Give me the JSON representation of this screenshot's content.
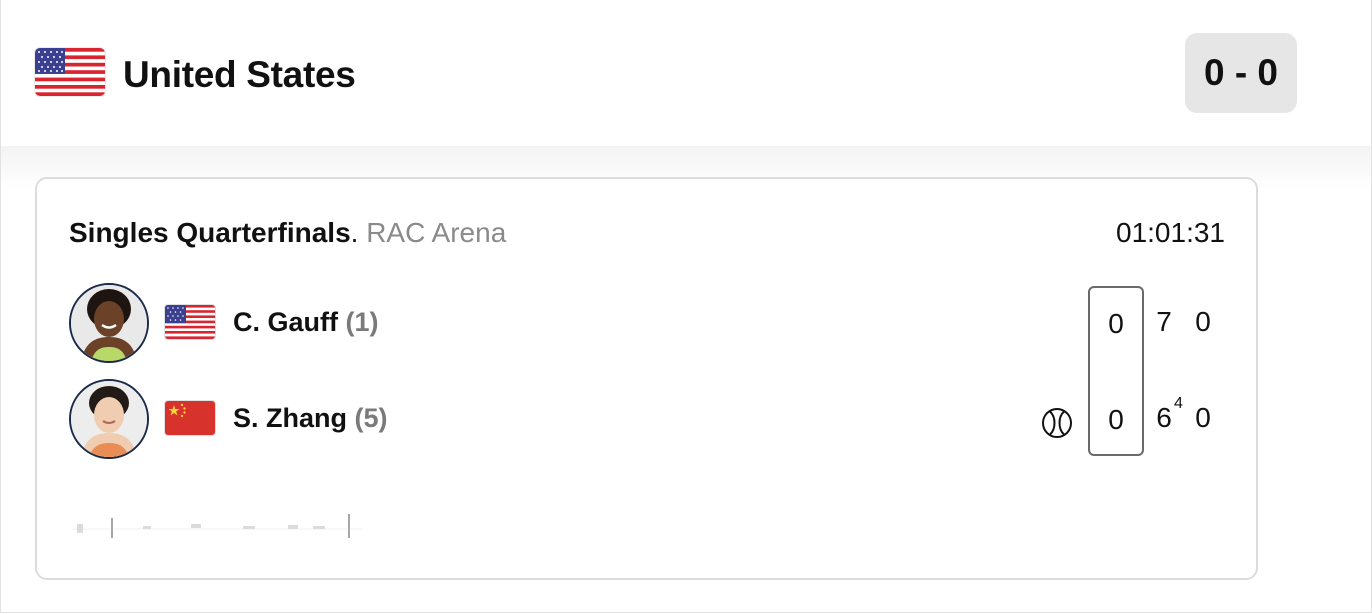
{
  "team": {
    "name": "United States",
    "score": "0 - 0",
    "flag_icon": "us-flag-icon"
  },
  "match": {
    "round": "Singles Quarterfinals",
    "separator": ".",
    "venue": "RAC Arena",
    "clock": "01:01:31",
    "serving_player_index": 1,
    "players": [
      {
        "name": "C. Gauff",
        "seed": "(1)",
        "flag_icon": "us-flag-icon",
        "avatar_icon": "player-avatar-icon",
        "current_game": "0",
        "sets": [
          "7",
          "0"
        ],
        "set_tiebreaks": [
          "",
          ""
        ]
      },
      {
        "name": "S. Zhang",
        "seed": "(5)",
        "flag_icon": "china-flag-icon",
        "avatar_icon": "player-avatar-icon",
        "current_game": "0",
        "sets": [
          "6",
          "0"
        ],
        "set_tiebreaks": [
          "4",
          ""
        ]
      }
    ]
  },
  "colors": {
    "score_pill_bg": "#e6e6e6",
    "venue_text": "#8a8a8a",
    "seed_text": "#7a7a7a",
    "avatar_ring": "#1c2b4a",
    "card_border": "#dcdcdc"
  }
}
